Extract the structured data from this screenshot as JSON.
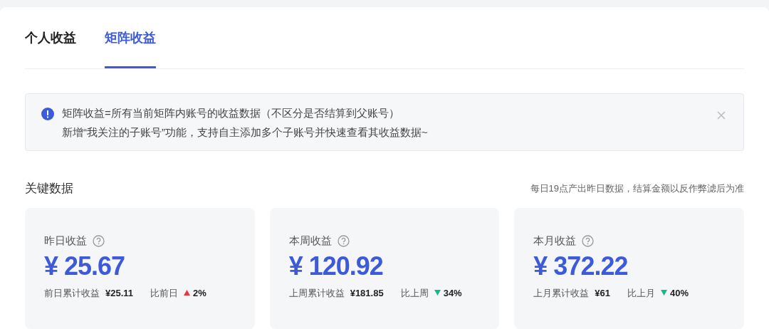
{
  "tabs": [
    {
      "label": "个人收益",
      "selected": false
    },
    {
      "label": "矩阵收益",
      "selected": true
    }
  ],
  "notice": {
    "lines": [
      "矩阵收益=所有当前矩阵内账号的收益数据（不区分是否结算到父账号）",
      "新增“我关注的子账号”功能，支持自主添加多个子账号并快速查看其收益数据~"
    ]
  },
  "section": {
    "title": "关键数据",
    "note": "每日19点产出昨日数据，结算金额以反作弊滤后为准"
  },
  "cards": [
    {
      "label": "昨日收益",
      "amount": "¥ 25.67",
      "prev_label": "前日累计收益",
      "prev_value": "¥25.11",
      "compare_label": "比前日",
      "rising": true,
      "change": "2%"
    },
    {
      "label": "本周收益",
      "amount": "¥ 120.92",
      "prev_label": "上周累计收益",
      "prev_value": "¥181.85",
      "compare_label": "比上周",
      "rising": false,
      "change": "34%"
    },
    {
      "label": "本月收益",
      "amount": "¥ 372.22",
      "prev_label": "上月累计收益",
      "prev_value": "¥61",
      "compare_label": "比上月",
      "rising": false,
      "change": "40%"
    }
  ]
}
